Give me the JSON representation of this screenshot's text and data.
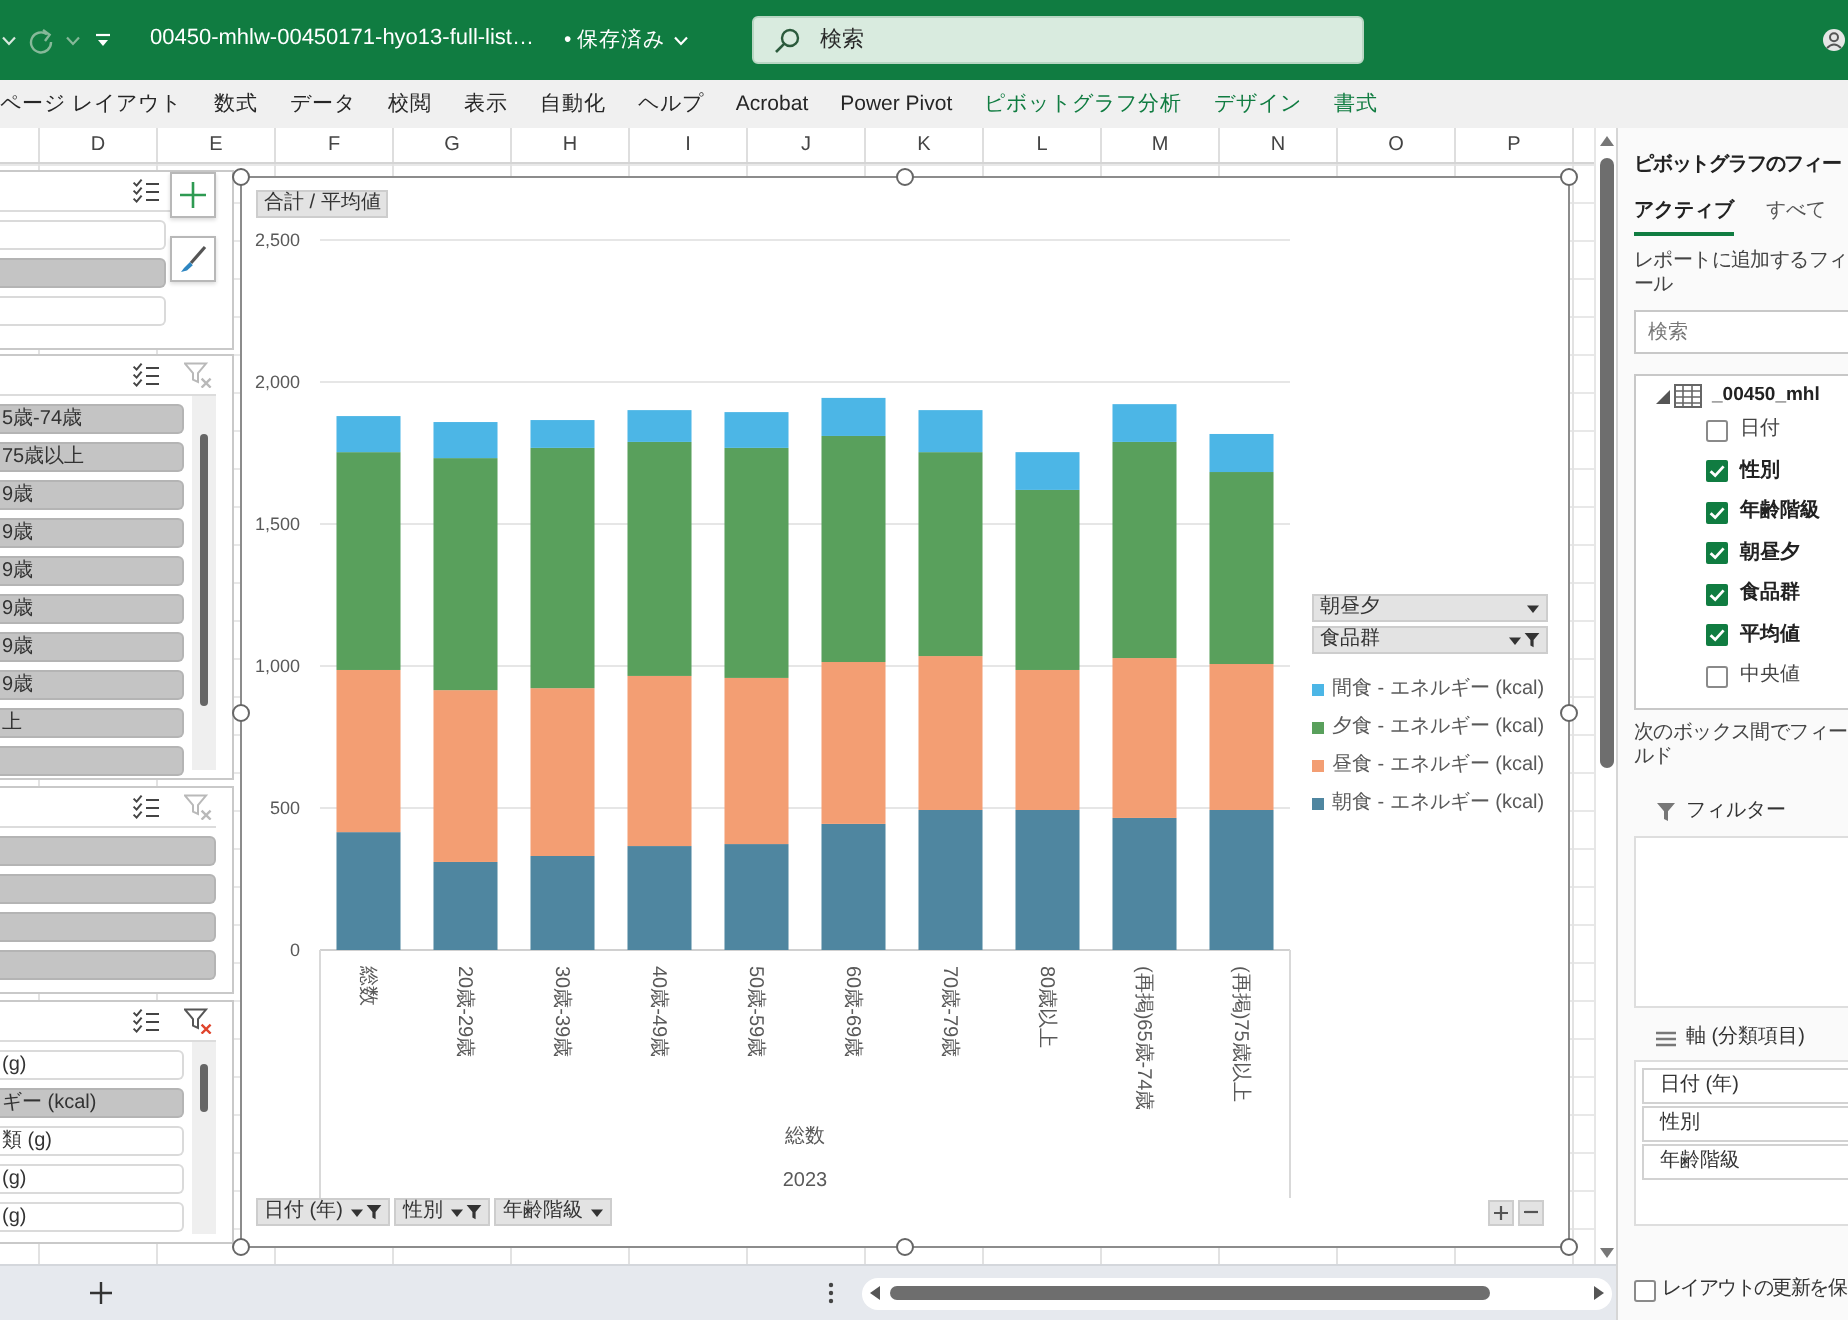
{
  "title_bar": {
    "file_name": "00450-mhlw-00450171-hyo13-full-list…",
    "save_status": "• 保存済み",
    "search": {
      "placeholder": "検索"
    }
  },
  "ribbon_tabs": [
    {
      "label": "ページ レイアウト",
      "contextual": false
    },
    {
      "label": "数式",
      "contextual": false
    },
    {
      "label": "データ",
      "contextual": false
    },
    {
      "label": "校閲",
      "contextual": false
    },
    {
      "label": "表示",
      "contextual": false
    },
    {
      "label": "自動化",
      "contextual": false
    },
    {
      "label": "ヘルプ",
      "contextual": false
    },
    {
      "label": "Acrobat",
      "contextual": false
    },
    {
      "label": "Power Pivot",
      "contextual": false
    },
    {
      "label": "ピボットグラフ分析",
      "contextual": true
    },
    {
      "label": "デザイン",
      "contextual": true
    },
    {
      "label": "書式",
      "contextual": true
    }
  ],
  "column_headers": [
    "D",
    "E",
    "F",
    "G",
    "H",
    "I",
    "J",
    "K",
    "L",
    "M",
    "N",
    "O",
    "P"
  ],
  "slicers": [
    {
      "scrollable": false,
      "items": [
        {
          "selected": false
        },
        {
          "selected": true
        },
        {
          "selected": false
        }
      ]
    },
    {
      "scrollable": true,
      "clear_filter_enabled": false,
      "items": [
        {
          "label": "5歳-74歳",
          "selected": true
        },
        {
          "label": "75歳以上",
          "selected": true
        },
        {
          "label": "9歳",
          "selected": true
        },
        {
          "label": "9歳",
          "selected": true
        },
        {
          "label": "9歳",
          "selected": true
        },
        {
          "label": "9歳",
          "selected": true
        },
        {
          "label": "9歳",
          "selected": true
        },
        {
          "label": "9歳",
          "selected": true
        },
        {
          "label": "上",
          "selected": true
        },
        {
          "selected": true
        }
      ]
    },
    {
      "scrollable": false,
      "clear_filter_enabled": false,
      "items": [
        {
          "selected": true
        },
        {
          "selected": true
        },
        {
          "selected": true
        },
        {
          "selected": true
        }
      ]
    },
    {
      "scrollable": true,
      "clear_filter_enabled": true,
      "items": [
        {
          "label": "(g)",
          "selected": false
        },
        {
          "label": "ギー (kcal)",
          "selected": true
        },
        {
          "label": "類 (g)",
          "selected": false
        },
        {
          "label": "(g)",
          "selected": false
        },
        {
          "label": "(g)",
          "selected": false
        }
      ]
    }
  ],
  "chart": {
    "value_field": "合計 / 平均値",
    "chart_data": {
      "type": "bar",
      "stacked": true,
      "grid": true,
      "categories": [
        "総数",
        "20歳-29歳",
        "30歳-39歳",
        "40歳-49歳",
        "50歳-59歳",
        "60歳-69歳",
        "70歳-79歳",
        "80歳以上",
        "(再掲)65歳-74歳",
        "(再掲)75歳以上"
      ],
      "series": [
        {
          "name": "朝食 - エネルギー (kcal)",
          "color": "#4f86a0",
          "values": [
            415,
            310,
            331,
            366,
            373,
            444,
            493,
            493,
            465,
            493
          ]
        },
        {
          "name": "昼食 - エネルギー (kcal)",
          "color": "#f39e73",
          "values": [
            571,
            605,
            591,
            599,
            585,
            570,
            542,
            493,
            563,
            514
          ]
        },
        {
          "name": "夕食 - エネルギー (kcal)",
          "color": "#59a05c",
          "values": [
            767,
            817,
            846,
            824,
            810,
            796,
            718,
            634,
            761,
            676
          ]
        },
        {
          "name": "間食 - エネルギー (kcal)",
          "color": "#4cb6e6",
          "values": [
            127,
            127,
            98,
            112,
            126,
            134,
            148,
            133,
            133,
            134
          ]
        }
      ],
      "ylim": [
        0,
        2500
      ],
      "yticks": [
        0,
        500,
        {
          "value": 1000,
          "label": "1,000"
        },
        {
          "value": 1500,
          "label": "1,500"
        },
        {
          "value": 2000,
          "label": "2,000"
        },
        {
          "value": 2500,
          "label": "2,500"
        }
      ]
    },
    "group_labels": [
      "総数",
      "2023"
    ],
    "legend_fields": [
      {
        "label": "朝昼夕",
        "filtered": false
      },
      {
        "label": "食品群",
        "filtered": true
      }
    ],
    "axis_fields": [
      {
        "label": "日付 (年)",
        "filtered": true
      },
      {
        "label": "性別",
        "filtered": true
      },
      {
        "label": "年齢階級",
        "filtered": false
      }
    ]
  },
  "field_pane": {
    "title": "ピボットグラフのフィー",
    "tabs": [
      {
        "label": "アクティブ",
        "selected": true
      },
      {
        "label": "すべて",
        "selected": false
      }
    ],
    "instruction": "レポートに追加するフィール",
    "search": {
      "placeholder": "検索"
    },
    "tree": {
      "label": "_00450_mhl",
      "expanded": true,
      "children": [
        {
          "label": "日付",
          "checked": false
        },
        {
          "label": "性別",
          "checked": true
        },
        {
          "label": "年齢階級",
          "checked": true
        },
        {
          "label": "朝昼夕",
          "checked": true
        },
        {
          "label": "食品群",
          "checked": true
        },
        {
          "label": "平均値",
          "checked": true
        },
        {
          "label": "中央値",
          "checked": false
        }
      ]
    },
    "areas_hint": "次のボックス間でフィールド",
    "filter_area": {
      "label": "フィルター"
    },
    "axis_area": {
      "label": "軸 (分類項目)",
      "items": [
        "日付 (年)",
        "性別",
        "年齢階級"
      ]
    },
    "defer_update": {
      "label": "レイアウトの更新を保",
      "checked": false
    }
  }
}
